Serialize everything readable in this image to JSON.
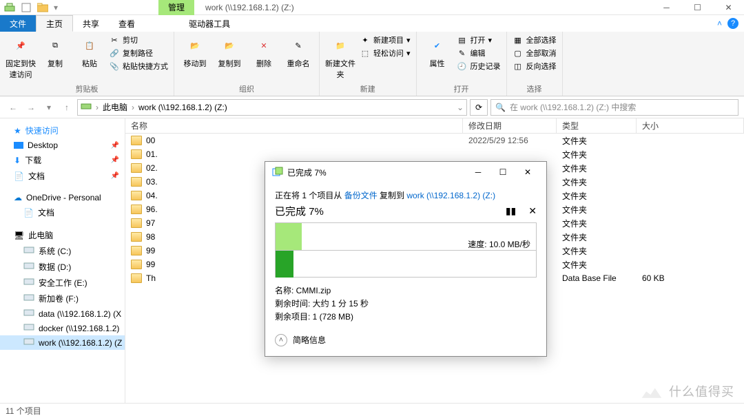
{
  "titlebar": {
    "context_tab": "管理",
    "window_title": "work (\\\\192.168.1.2) (Z:)"
  },
  "tabs": {
    "file": "文件",
    "home": "主页",
    "share": "共享",
    "view": "查看",
    "drive_tools": "驱动器工具"
  },
  "ribbon": {
    "clipboard": {
      "pin": "固定到快速访问",
      "copy": "复制",
      "paste": "粘贴",
      "cut": "剪切",
      "copy_path": "复制路径",
      "paste_shortcut": "粘贴快捷方式",
      "label": "剪贴板"
    },
    "organize": {
      "move_to": "移动到",
      "copy_to": "复制到",
      "delete": "删除",
      "rename": "重命名",
      "label": "组织"
    },
    "new": {
      "new_folder": "新建文件夹",
      "new_item": "新建项目",
      "easy_access": "轻松访问",
      "label": "新建"
    },
    "open": {
      "properties": "属性",
      "open": "打开",
      "edit": "编辑",
      "history": "历史记录",
      "label": "打开"
    },
    "select": {
      "select_all": "全部选择",
      "select_none": "全部取消",
      "invert": "反向选择",
      "label": "选择"
    }
  },
  "address": {
    "root": "此电脑",
    "current": "work (\\\\192.168.1.2) (Z:)"
  },
  "search": {
    "placeholder": "在 work (\\\\192.168.1.2) (Z:) 中搜索"
  },
  "nav": {
    "quick_access": "快速访问",
    "desktop": "Desktop",
    "downloads": "下载",
    "documents": "文档",
    "onedrive": "OneDrive - Personal",
    "od_docs": "文档",
    "this_pc": "此电脑",
    "drives": [
      "系统 (C:)",
      "数据 (D:)",
      "安全工作 (E:)",
      "新加卷 (F:)",
      "data (\\\\192.168.1.2) (X",
      "docker (\\\\192.168.1.2)",
      "work (\\\\192.168.1.2) (Z"
    ]
  },
  "columns": {
    "name": "名称",
    "date": "修改日期",
    "type": "类型",
    "size": "大小"
  },
  "files": [
    {
      "name": "00",
      "blur": "   ",
      "date": "2022/5/29 12:56",
      "type": "文件夹",
      "size": ""
    },
    {
      "name": "01.",
      "blur": "   ",
      "date": "",
      "type": "文件夹",
      "size": ""
    },
    {
      "name": "02.",
      "blur": "   ",
      "date": "",
      "type": "文件夹",
      "size": ""
    },
    {
      "name": "03.",
      "blur": "   ",
      "date": "",
      "type": "文件夹",
      "size": ""
    },
    {
      "name": "04.",
      "blur": "   ",
      "date": "",
      "type": "文件夹",
      "size": ""
    },
    {
      "name": "96.",
      "blur": "   ",
      "date": "",
      "type": "文件夹",
      "size": ""
    },
    {
      "name": "97",
      "blur": "   ",
      "date": "",
      "type": "文件夹",
      "size": ""
    },
    {
      "name": "98",
      "blur": "   ",
      "date": "",
      "type": "文件夹",
      "size": ""
    },
    {
      "name": "99",
      "blur": "   ",
      "date": "",
      "type": "文件夹",
      "size": ""
    },
    {
      "name": "99",
      "blur": "   ",
      "date": "",
      "type": "文件夹",
      "size": ""
    },
    {
      "name": "Th",
      "blur": "   ",
      "date": "",
      "type": "Data Base File",
      "size": "60 KB"
    }
  ],
  "status": {
    "count": "11 个项目"
  },
  "dialog": {
    "title": "已完成 7%",
    "copying_prefix": "正在将 1 个项目从 ",
    "src": "备份文件",
    "copying_mid": " 复制到 ",
    "dst": "work (\\\\192.168.1.2) (Z:)",
    "progress_label": "已完成 7%",
    "speed": "速度: 10.0 MB/秒",
    "name_label": "名称: ",
    "name_value": "CMMI.zip",
    "time_label": "剩余时间: ",
    "time_value": "大约 1 分 15 秒",
    "remain_label": "剩余项目: ",
    "remain_value": "1 (728 MB)",
    "more": "简略信息"
  },
  "watermark": "什么值得买"
}
